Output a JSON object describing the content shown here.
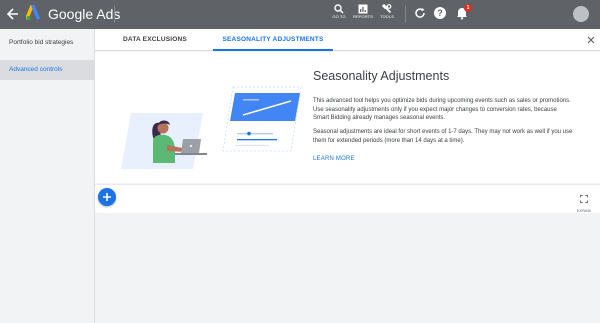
{
  "header": {
    "brand": "Google Ads",
    "tools": [
      {
        "label": "GO TO",
        "icon": "search-icon"
      },
      {
        "label": "REPORTS",
        "icon": "reports-icon"
      },
      {
        "label": "TOOLS",
        "icon": "wrench-icon"
      }
    ],
    "notification_count": "1",
    "colors": {
      "bar": "#5f6368",
      "badge": "#d93025"
    }
  },
  "sidebar": {
    "items": [
      {
        "label": "Portfolio bid strategies"
      },
      {
        "label": "Advanced controls"
      }
    ]
  },
  "tabs": [
    {
      "label": "DATA EXCLUSIONS"
    },
    {
      "label": "SEASONALITY ADJUSTMENTS"
    }
  ],
  "card": {
    "title": "Seasonality Adjustments",
    "paragraph1": "This advanced tool helps you optimize bids during upcoming events such as sales or promotions. Use seasonality adjustments only if you expect major changes to conversion rates, because Smart Bidding already manages seasonal events.",
    "paragraph2": "Seasonal adjustments are ideal for short events of 1-7 days. They may not work as well if you use them for extended periods (more than 14 days at a time).",
    "learn_more": "LEARN MORE"
  },
  "toolbar": {
    "expand_label": "EXPAND"
  },
  "accent_color": "#1a73e8"
}
